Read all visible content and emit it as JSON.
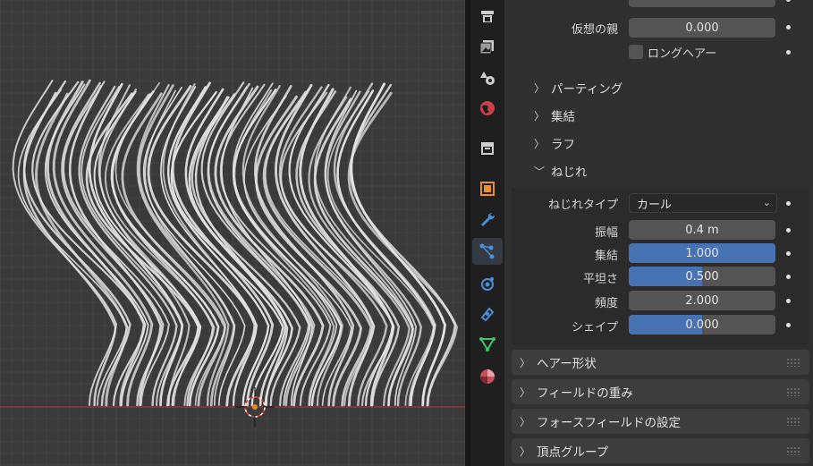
{
  "properties": {
    "virtual_parent": {
      "label": "仮想の親",
      "value": "0.000"
    },
    "long_hair": {
      "label": "ロングヘアー",
      "checked": false
    },
    "collapsed_sections": [
      {
        "label": "パーティング"
      },
      {
        "label": "集結"
      },
      {
        "label": "ラフ"
      }
    ],
    "twist_section": {
      "label": "ねじれ",
      "type": {
        "label": "ねじれタイプ",
        "value": "カール"
      },
      "fields": [
        {
          "label": "振幅",
          "value": "0.4 m",
          "highlighted": false
        },
        {
          "label": "集結",
          "value": "1.000",
          "highlighted": true
        },
        {
          "label": "平坦さ",
          "value": "0.500",
          "highlighted": true
        },
        {
          "label": "頻度",
          "value": "2.000",
          "highlighted": false
        },
        {
          "label": "シェイプ",
          "value": "0.000",
          "highlighted": true
        }
      ]
    },
    "panels": [
      {
        "label": "ヘアー形状"
      },
      {
        "label": "フィールドの重み"
      },
      {
        "label": "フォースフィールドの設定"
      },
      {
        "label": "頂点グループ"
      }
    ]
  },
  "tab_icons": [
    "output-icon",
    "view-layer-icon",
    "scene-icon",
    "world-icon",
    "collection-icon",
    "object-icon",
    "modifier-icon",
    "particles-icon",
    "physics-icon",
    "constraints-icon",
    "data-icon",
    "material-icon"
  ],
  "colors": {
    "accent_blue": "#4772b3",
    "panel_bg": "#303030",
    "viewport_bg": "#3a3a3a",
    "x_axis": "#9c3a3a"
  }
}
